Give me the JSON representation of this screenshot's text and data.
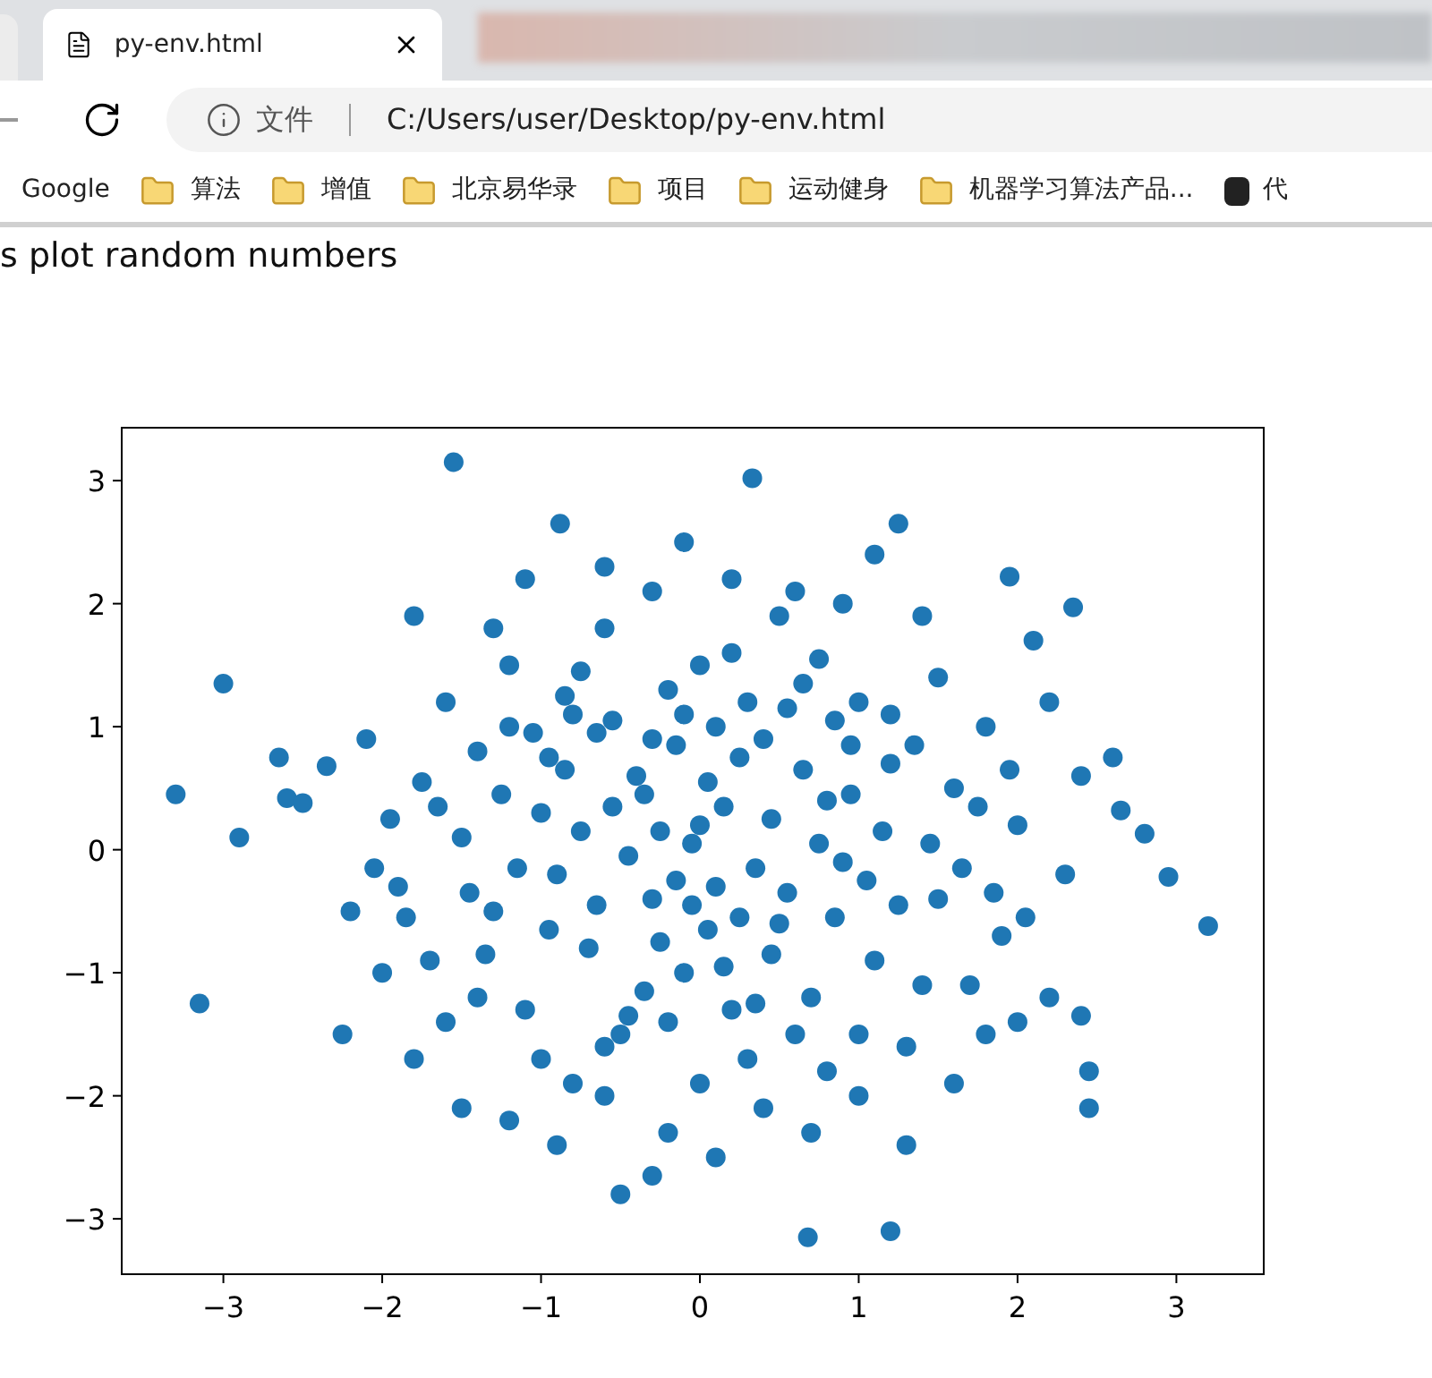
{
  "browser": {
    "tabs": [
      {
        "title": "py-env.html",
        "selected": true
      }
    ],
    "address_bar": {
      "security_label": "文件",
      "url": "C:/Users/user/Desktop/py-env.html"
    },
    "bookmarks": [
      {
        "label": "Google",
        "kind": "plain"
      },
      {
        "label": "算法",
        "kind": "folder"
      },
      {
        "label": "增值",
        "kind": "folder"
      },
      {
        "label": "北京易华录",
        "kind": "folder"
      },
      {
        "label": "项目",
        "kind": "folder"
      },
      {
        "label": "运动健身",
        "kind": "folder"
      },
      {
        "label": "机器学习算法产品...",
        "kind": "folder"
      },
      {
        "label": "代",
        "kind": "site"
      }
    ]
  },
  "page": {
    "heading": "s plot random numbers",
    "chart_data": {
      "type": "scatter",
      "xlim": [
        -3.64,
        3.55
      ],
      "ylim": [
        -3.45,
        3.43
      ],
      "xticks": [
        {
          "value": -3,
          "label": "−3"
        },
        {
          "value": -2,
          "label": "−2"
        },
        {
          "value": -1,
          "label": "−1"
        },
        {
          "value": 0,
          "label": "0"
        },
        {
          "value": 1,
          "label": "1"
        },
        {
          "value": 2,
          "label": "2"
        },
        {
          "value": 3,
          "label": "3"
        }
      ],
      "yticks": [
        {
          "value": 3,
          "label": "3"
        },
        {
          "value": 2,
          "label": "2"
        },
        {
          "value": 1,
          "label": "1"
        },
        {
          "value": 0,
          "label": "0"
        },
        {
          "value": -1,
          "label": "−1"
        },
        {
          "value": -2,
          "label": "−2"
        },
        {
          "value": -3,
          "label": "−3"
        }
      ],
      "x": [
        -3.3,
        -3.0,
        -2.9,
        -3.15,
        -2.65,
        -2.6,
        -2.5,
        -2.35,
        -2.25,
        -2.2,
        -1.55,
        -0.88,
        0.33,
        1.25,
        0.68,
        1.2,
        3.2,
        2.95,
        2.8,
        2.65,
        2.6,
        2.45,
        2.45,
        2.4,
        2.35,
        1.95,
        -0.5,
        -0.3,
        -1.8,
        -1.6,
        -1.4,
        -1.2,
        -1.0,
        -0.8,
        -0.6,
        -0.4,
        -0.2,
        0,
        0.2,
        0.4,
        0.6,
        0.8,
        1.0,
        1.2,
        1.4,
        1.6,
        1.8,
        2.0,
        -1.9,
        -1.7,
        -1.5,
        -1.3,
        -1.1,
        -0.9,
        -0.7,
        -0.5,
        -0.3,
        -0.1,
        0.1,
        0.3,
        0.5,
        0.7,
        0.9,
        1.1,
        1.3,
        1.5,
        1.7,
        1.9,
        -2.1,
        -2.0,
        -1.8,
        -1.5,
        -1.2,
        -0.9,
        -0.6,
        -0.2,
        0.1,
        0.4,
        0.7,
        1.0,
        1.3,
        1.6,
        2.0,
        2.2,
        2.3,
        2.4,
        2.2,
        2.1,
        -0.6,
        -0.3,
        -0.1,
        0.2,
        0.5,
        0.9,
        1.1,
        1.5,
        -1.1,
        -1.3,
        -0.05,
        0.15,
        -0.25,
        0.35,
        -0.45,
        0.05,
        0.25,
        -0.15,
        -0.35,
        0.45,
        0.55,
        -0.55,
        0.65,
        -0.65,
        0.75,
        -0.75,
        0.85,
        -0.85,
        0.95,
        -0.95,
        1.05,
        -1.05,
        1.15,
        -1.15,
        1.25,
        -1.25,
        1.35,
        -1.35,
        1.45,
        -1.45,
        0.05,
        -0.05,
        0.15,
        -0.15,
        0.25,
        -0.25,
        0.35,
        -0.35,
        0.45,
        -0.45,
        0.55,
        -0.55,
        0.65,
        -0.65,
        0.75,
        -0.75,
        0.85,
        -0.85,
        0.95,
        -0.95,
        1.65,
        -1.65,
        1.75,
        -1.75,
        1.85,
        -1.85,
        1.95,
        -1.95,
        2.05,
        -2.05,
        0.1,
        -0.1,
        0.3,
        -0.3,
        0.2,
        -0.2,
        0.6,
        -0.6,
        1.0,
        -1.0,
        1.2,
        -1.2,
        1.4,
        -1.4,
        0.0,
        0.0,
        0.8,
        -0.8,
        1.8,
        -1.6
      ],
      "series": [
        {
          "color": "#1f77b4",
          "values": [
            0.45,
            1.35,
            0.1,
            -1.25,
            0.75,
            0.42,
            0.38,
            0.68,
            -1.5,
            -0.5,
            3.15,
            2.65,
            3.02,
            2.65,
            -3.15,
            -3.1,
            -0.62,
            -0.22,
            0.13,
            0.32,
            0.75,
            -2.1,
            -1.8,
            -1.35,
            1.97,
            2.22,
            -2.8,
            -2.65,
            1.9,
            1.2,
            0.8,
            1.5,
            0.3,
            1.1,
            1.8,
            0.6,
            1.3,
            0.2,
            1.6,
            0.9,
            2.1,
            0.4,
            1.2,
            0.7,
            1.9,
            0.5,
            1.0,
            0.2,
            -0.3,
            -0.9,
            0.1,
            -0.5,
            -1.3,
            -0.2,
            -0.8,
            -1.5,
            -0.4,
            -1.0,
            -0.3,
            -1.7,
            -0.6,
            -1.2,
            -0.1,
            -0.9,
            -1.6,
            -0.4,
            -1.1,
            -0.7,
            0.9,
            -1.0,
            -1.7,
            -2.1,
            -2.2,
            -2.4,
            -2.0,
            -2.3,
            -2.5,
            -2.1,
            -2.3,
            -2.0,
            -2.4,
            -1.9,
            -1.4,
            -1.2,
            -0.2,
            0.6,
            1.2,
            1.7,
            2.3,
            2.1,
            2.5,
            2.2,
            1.9,
            2.0,
            2.4,
            1.4,
            2.2,
            1.8,
            0.05,
            0.35,
            0.15,
            -0.15,
            -0.05,
            0.55,
            0.75,
            0.85,
            0.45,
            0.25,
            -0.35,
            0.35,
            0.65,
            -0.45,
            0.05,
            0.15,
            -0.55,
            0.65,
            0.45,
            -0.65,
            -0.25,
            0.95,
            0.15,
            -0.15,
            -0.45,
            0.45,
            0.85,
            -0.85,
            0.05,
            -0.35,
            -0.65,
            -0.45,
            -0.95,
            -0.25,
            -0.55,
            -0.75,
            -1.25,
            -1.15,
            -0.85,
            -1.35,
            1.15,
            1.05,
            1.35,
            0.95,
            1.55,
            1.45,
            1.05,
            1.25,
            0.85,
            0.75,
            -0.15,
            0.35,
            0.35,
            0.55,
            -0.35,
            -0.55,
            0.65,
            0.25,
            -0.55,
            -0.15,
            1.0,
            1.1,
            1.2,
            0.9,
            -1.3,
            -1.4,
            -1.5,
            -1.6,
            -1.5,
            -1.7,
            1.1,
            1.0,
            -1.1,
            -1.2,
            1.5,
            -1.9,
            -1.8,
            -1.9,
            -1.5,
            -1.4
          ]
        }
      ]
    }
  }
}
